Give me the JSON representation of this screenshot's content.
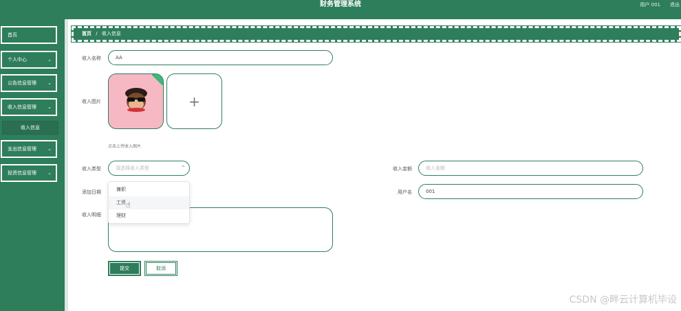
{
  "header": {
    "title": "财务管理系统",
    "user_label": "用户 001",
    "logout_label": "退出"
  },
  "sidebar": {
    "items": [
      {
        "label": "首页",
        "has_chevron": false
      },
      {
        "label": "个人中心",
        "has_chevron": true
      },
      {
        "label": "公告信息管理",
        "has_chevron": true
      },
      {
        "label": "收入信息管理",
        "has_chevron": true
      },
      {
        "label": "支出信息管理",
        "has_chevron": true
      },
      {
        "label": "投资信息管理",
        "has_chevron": true
      }
    ],
    "active_sub": "收入信息",
    "chevron": "⌄"
  },
  "breadcrumb": {
    "home": "首页",
    "sep": "/",
    "current": "收入信息"
  },
  "form": {
    "name_label": "收入名称",
    "name_value": "AA",
    "image_label": "收入图片",
    "add_symbol": "+",
    "upload_hint": "点击上传收入图片",
    "type_label": "收入类型",
    "type_placeholder": "请选择收入类型",
    "amount_label": "收入金额",
    "amount_placeholder": "收入金额",
    "date_label": "添加日期",
    "username_label": "用户名",
    "username_value": "001",
    "detail_label": "收入明细",
    "type_options": [
      "兼职",
      "工资",
      "理财"
    ],
    "hovered_option": "工资"
  },
  "buttons": {
    "submit": "提交",
    "cancel": "取消"
  },
  "watermark": "CSDN @畔云计算机毕设",
  "colors": {
    "primary": "#2e7d5b",
    "image_bg": "#f6b8c2",
    "tag": "#3cb878"
  },
  "icons": {
    "chevron": "chevron-down-icon",
    "add": "plus-icon",
    "cursor": "hand-pointer-icon",
    "avatar": "monkey-avatar-icon"
  }
}
